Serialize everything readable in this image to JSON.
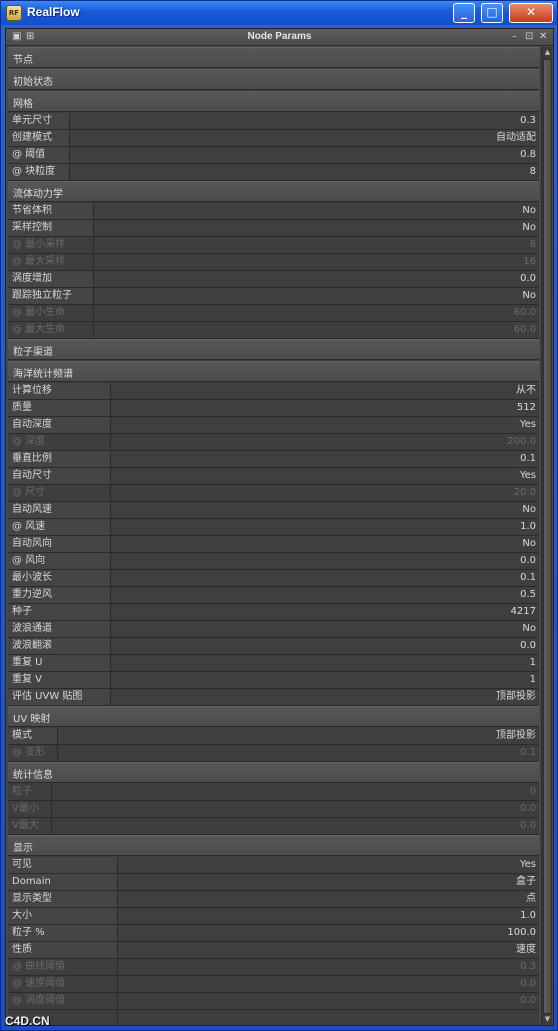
{
  "app": {
    "title": "RealFlow",
    "logo": "RF"
  },
  "window_buttons": {
    "minimize": "_",
    "maximize": "□",
    "close": "✕"
  },
  "panel": {
    "title": "Node Params",
    "icons": [
      "panel-menu-icon",
      "panel-grid-icon"
    ],
    "right_icons": [
      "–",
      "⊡",
      "✕"
    ]
  },
  "sections": [
    "节点",
    "初始状态",
    "网格",
    "流体动力学",
    "粒子渠道",
    "海洋统计频谱",
    "UV 映射",
    "统计信息",
    "显示"
  ],
  "mesh": [
    [
      "单元尺寸",
      "0.3"
    ],
    [
      "创建模式",
      "自动适配"
    ],
    [
      "@ 阈值",
      "0.8"
    ],
    [
      "@ 块粒度",
      "8"
    ]
  ],
  "dynamics": [
    [
      "节省体积",
      "No"
    ],
    [
      "采样控制",
      "No"
    ],
    [
      "@ 最小采样",
      "8"
    ],
    [
      "@ 最大采样",
      "16"
    ],
    [
      "涡度增加",
      "0.0"
    ],
    [
      "跟踪独立粒子",
      "No"
    ],
    [
      "@ 最小生命",
      "60.0"
    ],
    [
      "@ 最大生命",
      "60.0"
    ]
  ],
  "ocean": [
    [
      "计算位移",
      "从不"
    ],
    [
      "质量",
      "512"
    ],
    [
      "自动深度",
      "Yes"
    ],
    [
      "@ 深度",
      "200.0"
    ],
    [
      "垂直比例",
      "0.1"
    ],
    [
      "自动尺寸",
      "Yes"
    ],
    [
      "@ 尺寸",
      "20.0"
    ],
    [
      "自动风速",
      "No"
    ],
    [
      "@ 风速",
      "1.0"
    ],
    [
      "自动风向",
      "No"
    ],
    [
      "@ 风向",
      "0.0"
    ],
    [
      "最小波长",
      "0.1"
    ],
    [
      "重力逆风",
      "0.5"
    ],
    [
      "种子",
      "4217"
    ],
    [
      "波浪通道",
      "No"
    ],
    [
      "波浪翻滚",
      "0.0"
    ],
    [
      "重复 U",
      "1"
    ],
    [
      "重复 V",
      "1"
    ],
    [
      "评估 UVW 贴图",
      "顶部投影"
    ]
  ],
  "uv": [
    [
      "模式",
      "顶部投影"
    ],
    [
      "@ 变形",
      "0.1"
    ]
  ],
  "stats": [
    [
      "粒子",
      "0"
    ],
    [
      "V最小",
      "0.0"
    ],
    [
      "V最大",
      "0.0"
    ]
  ],
  "display": [
    [
      "可见",
      "Yes"
    ],
    [
      "Domain",
      "盒子"
    ],
    [
      "显示类型",
      "点"
    ],
    [
      "大小",
      "1.0"
    ],
    [
      "粒子 %",
      "100.0"
    ],
    [
      "性质",
      "速度"
    ],
    [
      "@ 曲线阈值",
      "0.3"
    ],
    [
      "@ 速度阈值",
      "0.0"
    ],
    [
      "@ 涡度阈值",
      "0.0"
    ],
    [
      "",
      ""
    ]
  ],
  "watermark": "C4D.CN"
}
